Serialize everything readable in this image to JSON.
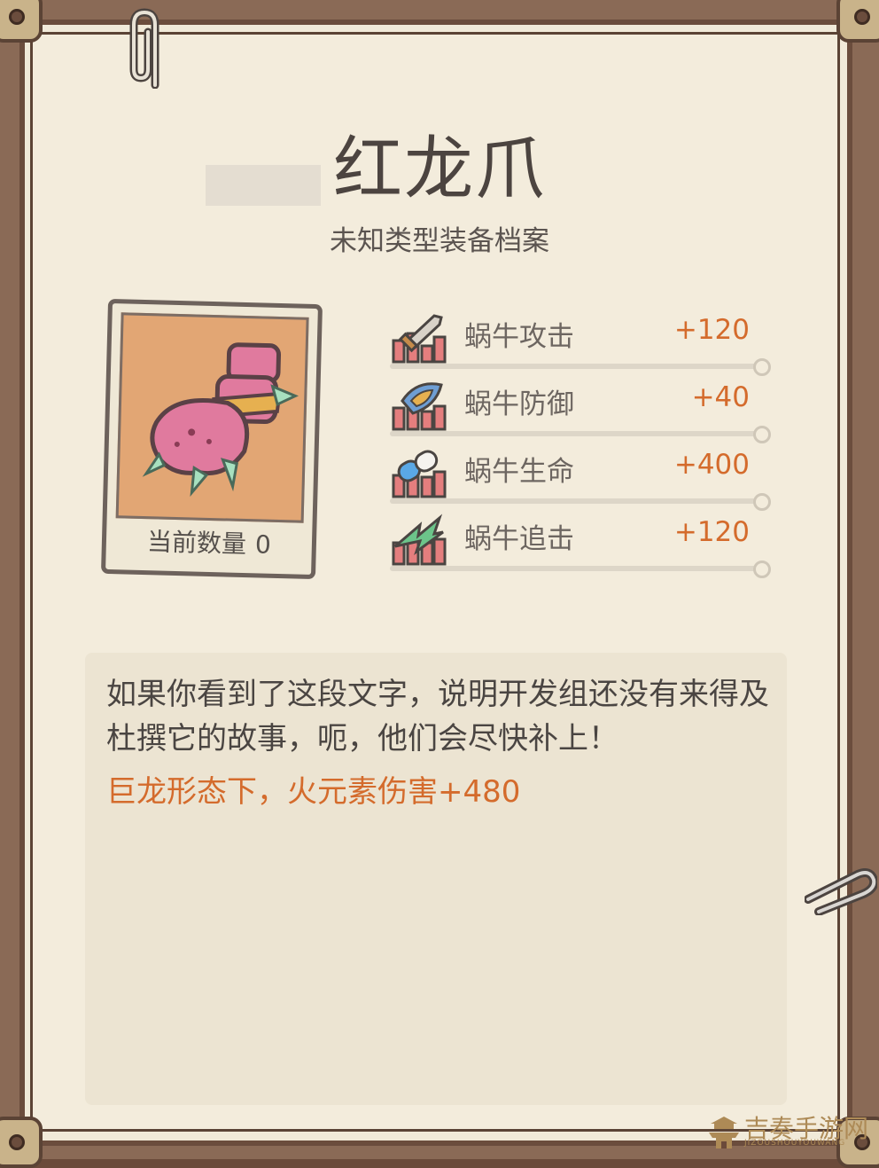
{
  "item": {
    "title": "红龙爪",
    "subtitle": "未知类型装备档案",
    "count_label": "当前数量",
    "count_value": "0",
    "icon": "red-dragon-claw-icon"
  },
  "stats": [
    {
      "name": "蜗牛攻击",
      "value": "+120",
      "icon": "attack-sword-icon"
    },
    {
      "name": "蜗牛防御",
      "value": "+40",
      "icon": "defense-shield-icon"
    },
    {
      "name": "蜗牛生命",
      "value": "+400",
      "icon": "life-pill-icon"
    },
    {
      "name": "蜗牛追击",
      "value": "+120",
      "icon": "pursuit-lightning-icon"
    }
  ],
  "description": {
    "text": "如果你看到了这段文字，说明开发组还没有来得及杜撰它的故事，呃，他们会尽快补上！",
    "effect": "巨龙形态下，火元素伤害+480"
  },
  "watermark": {
    "text": "吉奏手游网",
    "sub": "JIZOUSHOUYOUWANG"
  },
  "colors": {
    "accent": "#d46b2c",
    "text": "#4a4542",
    "paper": "#f3ecdc",
    "frame": "#6b4d3d"
  }
}
